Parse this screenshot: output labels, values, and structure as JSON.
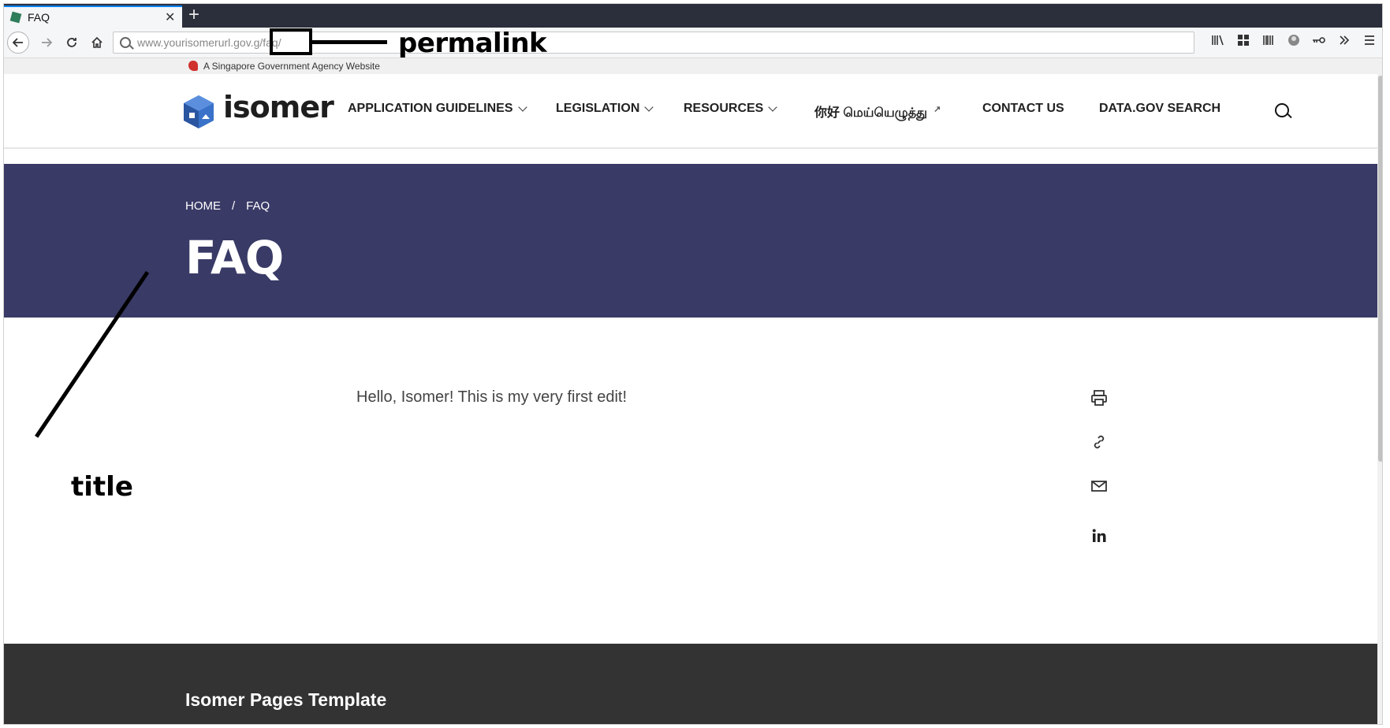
{
  "tab": {
    "title": "FAQ",
    "close_glyph": "✕",
    "new_tab_glyph": "+"
  },
  "toolbar": {
    "url_domain": "www.yourisomerurl.gov.",
    "url_path": "g/faq/"
  },
  "annotations": {
    "permalink": "permalink",
    "title": "title"
  },
  "gov_banner": {
    "text": "A Singapore Government Agency Website"
  },
  "site": {
    "logo_text": "isomer",
    "menu": [
      {
        "label": "APPLICATION GUIDELINES"
      },
      {
        "label": "LEGISLATION"
      },
      {
        "label": "RESOURCES"
      },
      {
        "label": "你好 மெய்யெழுத்து"
      },
      {
        "label": "CONTACT US"
      },
      {
        "label": "DATA.GOV SEARCH"
      }
    ]
  },
  "breadcrumb": {
    "home": "HOME",
    "sep": "/",
    "current": "FAQ"
  },
  "page": {
    "title": "FAQ",
    "body": "Hello, Isomer! This is my very first edit!"
  },
  "footer": {
    "title": "Isomer Pages Template"
  },
  "colors": {
    "hero": "#393a66",
    "footer": "#333333",
    "brand_blue": "#3a72c9"
  }
}
